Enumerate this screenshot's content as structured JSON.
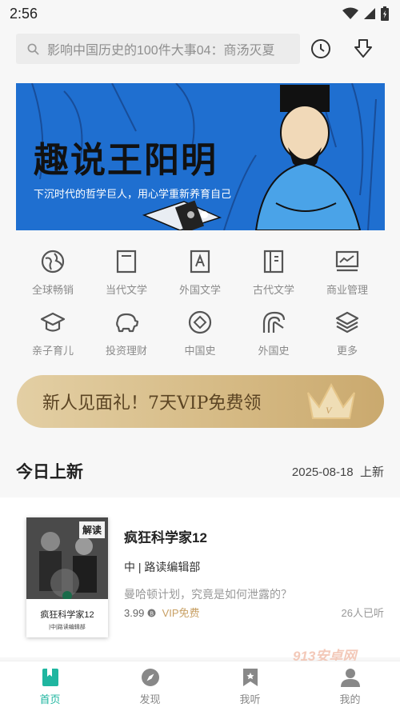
{
  "status_bar": {
    "time": "2:56"
  },
  "search": {
    "placeholder": "影响中国历史的100件大事04：商汤灭夏"
  },
  "banner": {
    "title": "趣说王阳明",
    "subtitle": "下沉时代的哲学巨人，用心学重新养育自己",
    "slides_total": 2,
    "active_slide": 2
  },
  "categories": [
    {
      "label": "全球畅销",
      "icon": "globe-icon"
    },
    {
      "label": "当代文学",
      "icon": "book-icon"
    },
    {
      "label": "外国文学",
      "icon": "letter-a-icon"
    },
    {
      "label": "古代文学",
      "icon": "scroll-book-icon"
    },
    {
      "label": "商业管理",
      "icon": "chart-icon"
    },
    {
      "label": "亲子育儿",
      "icon": "graduation-cap-icon"
    },
    {
      "label": "投资理财",
      "icon": "piggy-bank-icon"
    },
    {
      "label": "中国史",
      "icon": "diamond-icon"
    },
    {
      "label": "外国史",
      "icon": "rainbow-icon"
    },
    {
      "label": "更多",
      "icon": "layers-icon"
    }
  ],
  "promo": {
    "text": "新人见面礼！7天VIP免费领",
    "icon": "crown-icon"
  },
  "section": {
    "title": "今日上新",
    "date": "2025-08-18",
    "date_suffix": "上新"
  },
  "book": {
    "badge": "解读",
    "cover_title": "疯狂科学家12",
    "cover_author": "|中|路读编辑部",
    "title": "疯狂科学家12",
    "author": "中 | 路读编辑部",
    "description": "曼哈顿计划，究竟是如何泄露的？",
    "price": "3.99",
    "price_icon": "coin-icon",
    "vip_label": "VIP免费",
    "listeners": "26人已听"
  },
  "watermark": "913安卓网",
  "tabs": [
    {
      "label": "首页",
      "icon": "bookmark-book-icon",
      "active": true
    },
    {
      "label": "发现",
      "icon": "compass-icon",
      "active": false
    },
    {
      "label": "我听",
      "icon": "bookmark-icon",
      "active": false
    },
    {
      "label": "我的",
      "icon": "user-icon",
      "active": false
    }
  ],
  "colors": {
    "accent": "#1fb6a0",
    "banner_bg": "#1f6fd0",
    "vip_gold": "#c8a064",
    "promo_text": "#5b4423"
  }
}
